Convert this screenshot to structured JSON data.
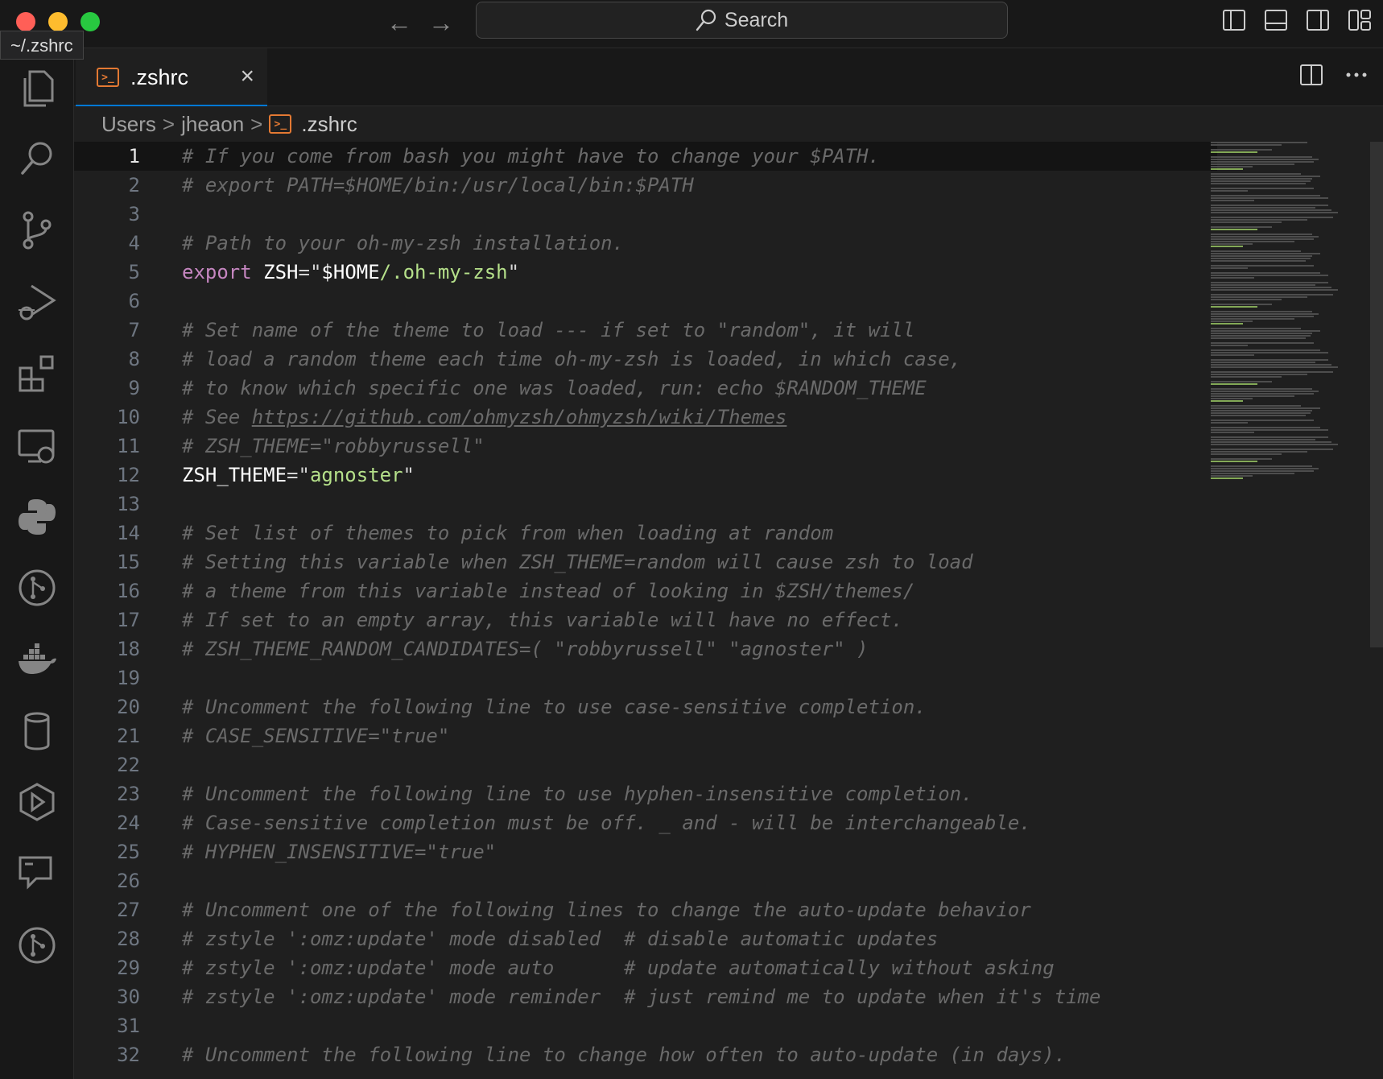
{
  "window": {
    "search_label": "Search",
    "tooltip": "~/.zshrc"
  },
  "tab": {
    "label": ".zshrc",
    "close_glyph": "×",
    "icon": "terminal-file-icon"
  },
  "breadcrumb": {
    "items": [
      "Users",
      "jheaon",
      ".zshrc"
    ],
    "separator": ">"
  },
  "activity_bar": [
    {
      "name": "explorer-icon"
    },
    {
      "name": "search-icon"
    },
    {
      "name": "source-control-icon"
    },
    {
      "name": "run-debug-icon"
    },
    {
      "name": "extensions-icon"
    },
    {
      "name": "remote-explorer-icon"
    },
    {
      "name": "python-icon"
    },
    {
      "name": "git-graph-icon"
    },
    {
      "name": "docker-icon"
    },
    {
      "name": "database-icon"
    },
    {
      "name": "kubernetes-icon"
    },
    {
      "name": "chat-icon"
    },
    {
      "name": "git-lens-icon"
    }
  ],
  "editor": {
    "current_line": 1,
    "lines": [
      {
        "n": "1",
        "t": "# If you come from bash you might have to change your $PATH."
      },
      {
        "n": "2",
        "t": "# export PATH=$HOME/bin:/usr/local/bin:$PATH"
      },
      {
        "n": "3",
        "t": ""
      },
      {
        "n": "4",
        "t": "# Path to your oh-my-zsh installation."
      },
      {
        "n": "5",
        "t": "export ZSH=\"$HOME/.oh-my-zsh\""
      },
      {
        "n": "6",
        "t": ""
      },
      {
        "n": "7",
        "t": "# Set name of the theme to load --- if set to \"random\", it will"
      },
      {
        "n": "8",
        "t": "# load a random theme each time oh-my-zsh is loaded, in which case,"
      },
      {
        "n": "9",
        "t": "# to know which specific one was loaded, run: echo $RANDOM_THEME"
      },
      {
        "n": "10",
        "t": "# See https://github.com/ohmyzsh/ohmyzsh/wiki/Themes"
      },
      {
        "n": "11",
        "t": "# ZSH_THEME=\"robbyrussell\""
      },
      {
        "n": "12",
        "t": "ZSH_THEME=\"agnoster\""
      },
      {
        "n": "13",
        "t": ""
      },
      {
        "n": "14",
        "t": "# Set list of themes to pick from when loading at random"
      },
      {
        "n": "15",
        "t": "# Setting this variable when ZSH_THEME=random will cause zsh to load"
      },
      {
        "n": "16",
        "t": "# a theme from this variable instead of looking in $ZSH/themes/"
      },
      {
        "n": "17",
        "t": "# If set to an empty array, this variable will have no effect."
      },
      {
        "n": "18",
        "t": "# ZSH_THEME_RANDOM_CANDIDATES=( \"robbyrussell\" \"agnoster\" )"
      },
      {
        "n": "19",
        "t": ""
      },
      {
        "n": "20",
        "t": "# Uncomment the following line to use case-sensitive completion."
      },
      {
        "n": "21",
        "t": "# CASE_SENSITIVE=\"true\""
      },
      {
        "n": "22",
        "t": ""
      },
      {
        "n": "23",
        "t": "# Uncomment the following line to use hyphen-insensitive completion."
      },
      {
        "n": "24",
        "t": "# Case-sensitive completion must be off. _ and - will be interchangeable."
      },
      {
        "n": "25",
        "t": "# HYPHEN_INSENSITIVE=\"true\""
      },
      {
        "n": "26",
        "t": ""
      },
      {
        "n": "27",
        "t": "# Uncomment one of the following lines to change the auto-update behavior"
      },
      {
        "n": "28",
        "t": "# zstyle ':omz:update' mode disabled  # disable automatic updates"
      },
      {
        "n": "29",
        "t": "# zstyle ':omz:update' mode auto      # update automatically without asking"
      },
      {
        "n": "30",
        "t": "# zstyle ':omz:update' mode reminder  # just remind me to update when it's time"
      },
      {
        "n": "31",
        "t": ""
      },
      {
        "n": "32",
        "t": "# Uncomment the following line to change how often to auto-update (in days)."
      }
    ]
  },
  "colors": {
    "background": "#1f1f1f",
    "comment": "#6a6a6a",
    "keyword": "#c586c0",
    "string": "#b5e08a",
    "file_icon": "#e37933",
    "tab_accent": "#0078d4"
  }
}
